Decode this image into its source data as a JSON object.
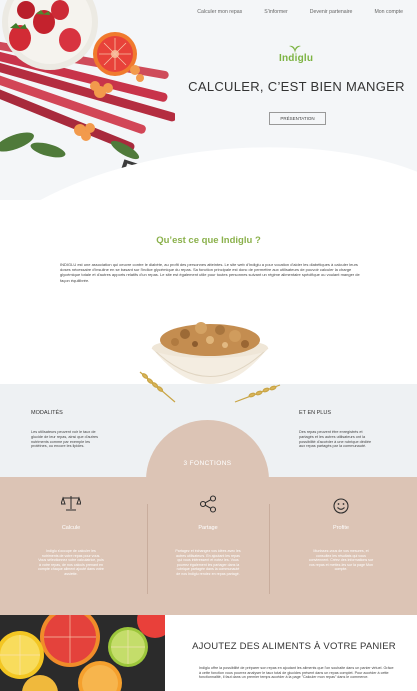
{
  "nav": {
    "items": [
      "Calculer mon repas",
      "S'informer",
      "Devenir partenaire",
      "Mon compte"
    ]
  },
  "logo": {
    "text": "Indiglu"
  },
  "hero": {
    "title": "CALCULER, C’EST BIEN MANGER",
    "button": "PRÉSENTATION"
  },
  "about": {
    "title": "Qu’est ce que Indiglu ?",
    "text": "INDIGLU est une association qui oeuvre contre le diabète, au profit des personnes atteintes. Le site web d'Indiglu a pour vocation d'aider les diabétiques à calculer leurs doses nécessaire d'insuline en se basant sur l'indice glycémique du repas. Sa fonction principale est donc de permettre aux utilisateurs de pouvoir calculer la charge glycémique totale et d'autres apports relatifs d'un repas. Le site est également utile pour toutes personnes suivant un régime alimentaire spécifique ou voulant manger de façon équilibrée."
  },
  "columns": {
    "left": {
      "title": "MODALITÉS",
      "text": "Les utilisateurs peuvent voir le taux de glucide de leur repas, ainsi que d'autres nutriments comme par exemple les protéines, ou encore les lipides."
    },
    "right": {
      "title": "ET EN PLUS",
      "text": "Des repas peuvent être enregistrés et partagés et les autres utilisateurs ont la possibilité d'accéder à une rubrique dédiée aux repas partagés par la communauté."
    }
  },
  "functions": {
    "heading": "3 FONCTIONS",
    "items": [
      {
        "icon": "scale-icon",
        "name": "Calcule",
        "text": "Indiglu s'occupe de calculer les nutriments de votre repas pour vous. Vous sélectionnez votre calculatrice, puis à votre repas, de nos calculs prenant en compte chaque aliment ajouté dans votre assiette."
      },
      {
        "icon": "share-icon",
        "name": "Partage",
        "text": "Partagez et échangez vos idées avec les autres utilisateurs. En ajoutant les repas qui vous intéressent et notez les. Vous pourrez également les partager dans la rubrique partagée dans la communauté de nos Indiglu rendez en repas partagé."
      },
      {
        "icon": "smiley-icon",
        "name": "Profite",
        "text": "Munissez-vous de vos mesures, et consultez les résultats qui vous conviennent. Créez des informations sur vos repas et mettez-les sur la page Mon compte."
      }
    ]
  },
  "bottom": {
    "title": "AJOUTEZ DES ALIMENTS À VOTRE PANIER",
    "text": "Indiglu offre la possibilité de préparer son repas en ajoutant les aliments que l'on souhaite dans un panier virtuel. Grâce à cette fonction vous pourrez analyser le taux total de glucides présent dans un repas complet. Pour accéder à cette fonctionnalité, il faut dans un premier temps accéder à la page \"Calculer mon repas\" dans le commerce."
  },
  "colors": {
    "accent": "#8bb14c",
    "functions_bg": "#dcc4b5",
    "band_bg": "#eef1f3"
  }
}
